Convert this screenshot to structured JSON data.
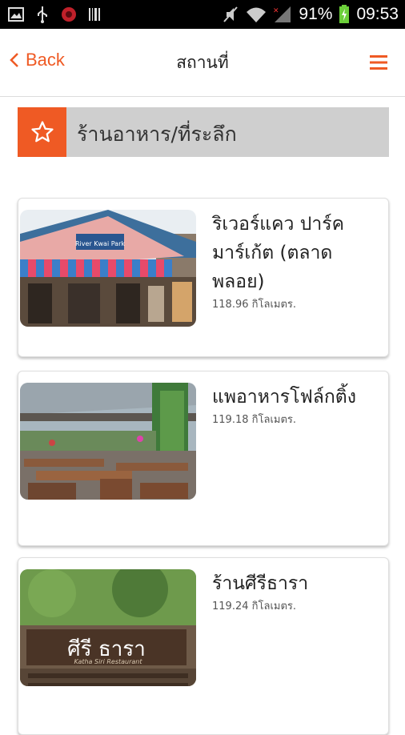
{
  "status_bar": {
    "battery_percent": "91%",
    "time": "09:53"
  },
  "header": {
    "back_label": "Back",
    "title": "สถานที่"
  },
  "category": {
    "label": "ร้านอาหาร/ที่ระลึก"
  },
  "places": [
    {
      "name": "ริเวอร์แคว ปาร์ค มาร์เก้ต (ตลาดพลอย)",
      "distance": "118.96 กิโลเมตร.",
      "sign_text": "River Kwai Park"
    },
    {
      "name": "แพอาหารโฟล์กติ้ง",
      "distance": "119.18 กิโลเมตร."
    },
    {
      "name": "ร้านศีรีธารา",
      "distance": "119.24 กิโลเมตร.",
      "sign_text": "ศีรี ธารา",
      "sign_subtext": "Katha Siri Restaurant"
    }
  ],
  "colors": {
    "accent": "#ef5a24",
    "category_bg": "#cfcfcf"
  }
}
